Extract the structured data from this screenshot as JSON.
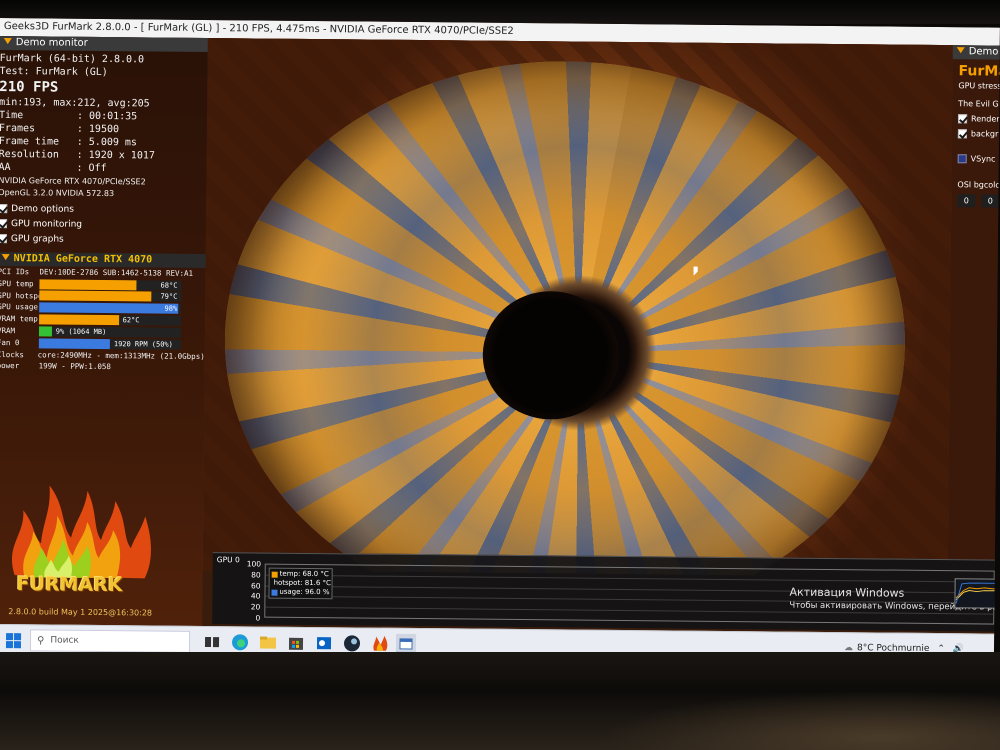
{
  "window": {
    "title": "Geeks3D FurMark 2.8.0.0 - [ FurMark (GL) ] - 210 FPS, 4.475ms - NVIDIA GeForce RTX 4070/PCIe/SSE2"
  },
  "left_panel": {
    "header": "Demo monitor",
    "app_line": "FurMark (64-bit) 2.8.0.0",
    "test_line": "Test: FurMark (GL)",
    "fps_line": "210 FPS",
    "minmax_line": "min:193, max:212, avg:205",
    "stats": [
      {
        "key": "Time",
        "value": "00:01:35"
      },
      {
        "key": "Frames",
        "value": "19500"
      },
      {
        "key": "Frame time",
        "value": "5.009 ms"
      },
      {
        "key": "Resolution",
        "value": "1920 x 1017"
      },
      {
        "key": "AA",
        "value": "Off"
      }
    ],
    "gpu_renderer": "NVIDIA GeForce RTX 4070/PCIe/SSE2",
    "gl_version": "OpenGL 3.2.0 NVIDIA 572.83",
    "options": [
      {
        "label": "Demo options",
        "checked": true
      },
      {
        "label": "GPU monitoring",
        "checked": true
      },
      {
        "label": "GPU graphs",
        "checked": true
      }
    ]
  },
  "gpu_section": {
    "header": "NVIDIA GeForce RTX 4070",
    "rows": [
      {
        "label": "PCI IDs",
        "text": "DEV:10DE-2786 SUB:1462-5138 REV:A1"
      },
      {
        "label": "GPU temp",
        "bar_value": "68°C",
        "fill": 0.68,
        "color": "#f5a000"
      },
      {
        "label": "GPU hotspot",
        "bar_value": "79°C",
        "fill": 0.79,
        "color": "#f5a000"
      },
      {
        "label": "GPU usage",
        "bar_value": "98%",
        "fill": 0.98,
        "color": "#3b7be0"
      },
      {
        "label": "VRAM temp",
        "bar_value": "62°C",
        "fill": 0.56,
        "color": "#f5a000"
      },
      {
        "label": "VRAM",
        "bar_value": "9% (1064 MB)",
        "fill": 0.09,
        "color": "#35c135"
      },
      {
        "label": "Fan 0",
        "bar_value": "1920 RPM (50%)",
        "fill": 0.5,
        "color": "#3b7be0"
      },
      {
        "label": "Clocks",
        "text": "core:2490MHz - mem:1313MHz (21.0Gbps)"
      },
      {
        "label": "power",
        "text": "199W - PPW:1.058"
      }
    ]
  },
  "logo": {
    "word": "FURMARK",
    "build": "2.8.0.0 build May 1 2025@16:30:28"
  },
  "right_panel": {
    "header": "Demo",
    "title": "FurMark",
    "subtitle": "GPU stress",
    "section": "The Evil GP",
    "checks": [
      {
        "label": "Render",
        "checked": true
      },
      {
        "label": "backgr",
        "checked": true
      }
    ],
    "vsync_label": "VSync",
    "vsync_checked": false,
    "osi_label": "OSI bgcolor",
    "osi_values": [
      "0",
      "0"
    ]
  },
  "graph": {
    "label": "GPU 0",
    "y_ticks": [
      "100",
      "80",
      "60",
      "40",
      "20",
      "0"
    ],
    "legend": [
      {
        "label": "temp: 68.0 °C",
        "color": "#f5a000"
      },
      {
        "label": "hotspot: 81.6 °C",
        "color": "#f5a000"
      },
      {
        "label": "usage: 96.0 %",
        "color": "#3b7be0"
      }
    ]
  },
  "activation": {
    "title": "Активация Windows",
    "subtitle": "Чтобы активировать Windows, перейдите в разде"
  },
  "taskbar": {
    "search_placeholder": "Поиск",
    "weather": "8°C Pochmurnie"
  }
}
